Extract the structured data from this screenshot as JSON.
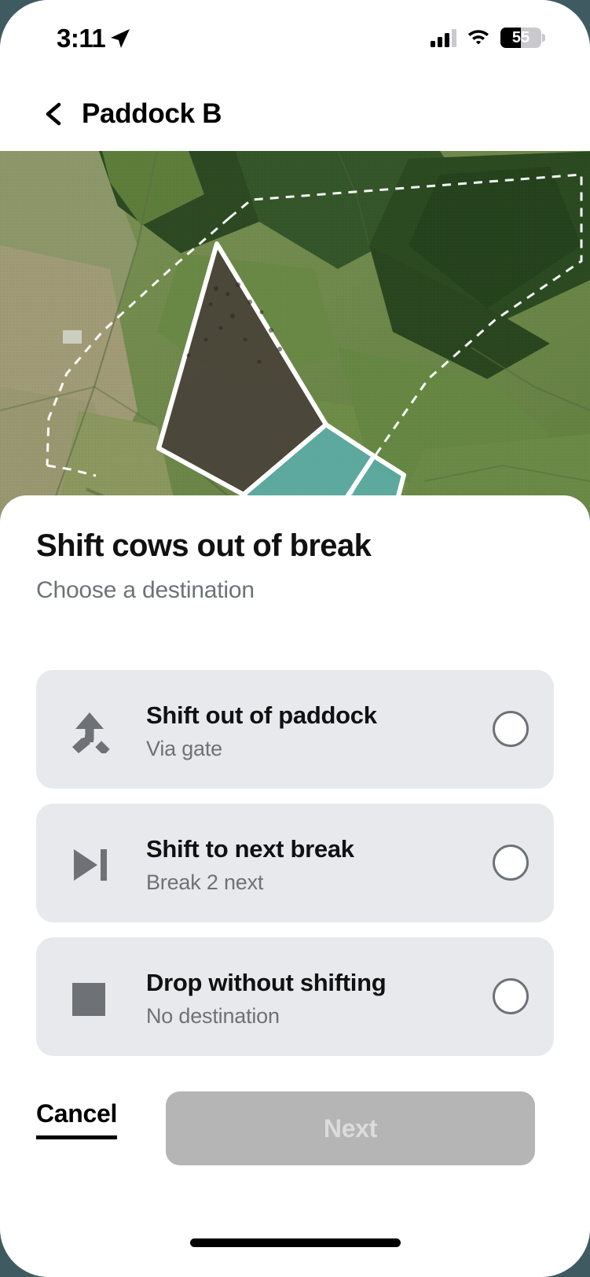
{
  "status_bar": {
    "time": "3:11",
    "location_icon": "location-arrow-icon",
    "signal_icon": "cellular-signal-icon",
    "signal_bars_filled": 3,
    "signal_bars_total": 4,
    "wifi_icon": "wifi-icon",
    "battery_percent": "55",
    "battery_icon": "battery-icon"
  },
  "nav": {
    "back_icon": "chevron-left-icon",
    "title": "Paddock B"
  },
  "map": {
    "alt": "satellite-map-of-paddock",
    "colors": {
      "break_fill": "#5fb8c4",
      "grazed_fill": "#4a413c",
      "outline": "#ffffff",
      "paddock_boundary": "#ffffff"
    }
  },
  "sheet": {
    "title": "Shift cows out of break",
    "subtitle": "Choose a destination",
    "options": [
      {
        "icon": "merge-arrow-icon",
        "label": "Shift out of paddock",
        "sublabel": "Via gate",
        "selected": false
      },
      {
        "icon": "skip-next-icon",
        "label": "Shift to next break",
        "sublabel": "Break 2 next",
        "selected": false
      },
      {
        "icon": "stop-square-icon",
        "label": "Drop without shifting",
        "sublabel": "No destination",
        "selected": false
      }
    ],
    "cancel_label": "Cancel",
    "next_label": "Next",
    "next_enabled": false
  },
  "colors": {
    "card_bg": "#e7e9ec",
    "muted_text": "#6e7277",
    "disabled_button": "#b5b5b5",
    "disabled_button_text": "#dcdcdc"
  }
}
